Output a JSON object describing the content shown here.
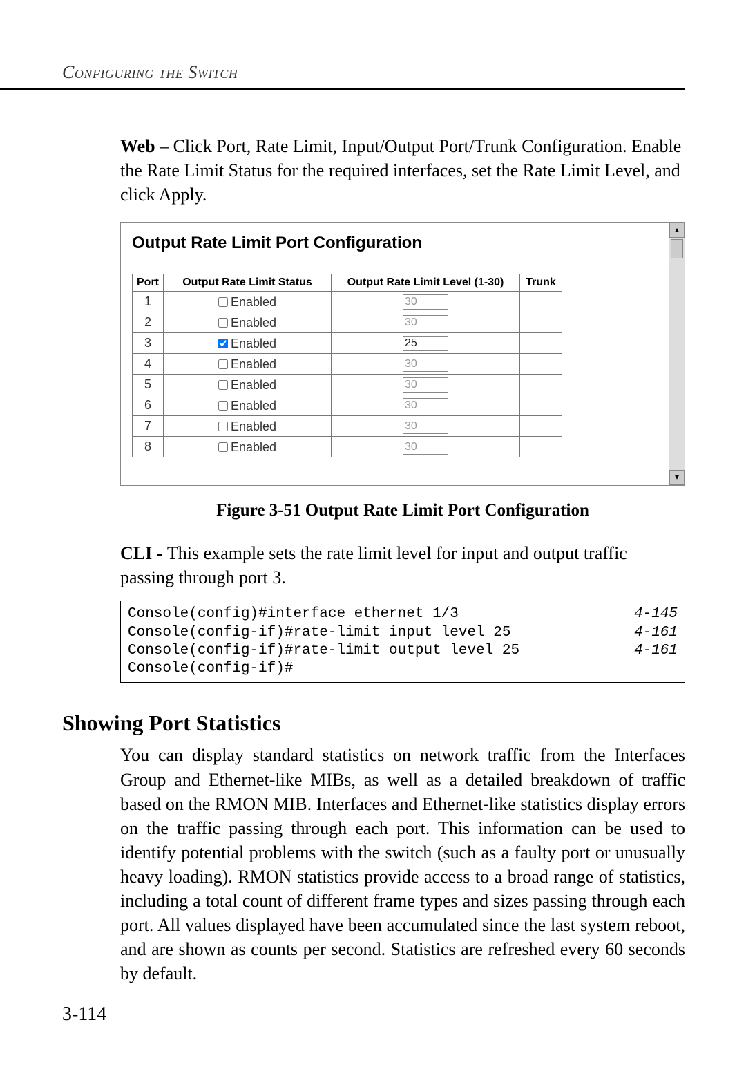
{
  "running_head": "Configuring the Switch",
  "intro": {
    "prefix_bold": "Web",
    "text_after": " – Click Port, Rate Limit, Input/Output Port/Trunk Configuration. Enable the Rate Limit Status for the required interfaces, set the Rate Limit Level, and click Apply."
  },
  "figure": {
    "panel_title": "Output Rate Limit Port Configuration",
    "caption": "Figure 3-51  Output Rate Limit Port Configuration",
    "headers": {
      "port": "Port",
      "status": "Output Rate Limit Status",
      "level": "Output Rate Limit Level (1-30)",
      "trunk": "Trunk"
    },
    "enabled_label": "Enabled",
    "rows": [
      {
        "port": "1",
        "enabled": false,
        "level": "30",
        "trunk": ""
      },
      {
        "port": "2",
        "enabled": false,
        "level": "30",
        "trunk": ""
      },
      {
        "port": "3",
        "enabled": true,
        "level": "25",
        "trunk": ""
      },
      {
        "port": "4",
        "enabled": false,
        "level": "30",
        "trunk": ""
      },
      {
        "port": "5",
        "enabled": false,
        "level": "30",
        "trunk": ""
      },
      {
        "port": "6",
        "enabled": false,
        "level": "30",
        "trunk": ""
      },
      {
        "port": "7",
        "enabled": false,
        "level": "30",
        "trunk": ""
      },
      {
        "port": "8",
        "enabled": false,
        "level": "30",
        "trunk": ""
      }
    ]
  },
  "cli_intro": {
    "prefix_bold": "CLI - ",
    "text_after": "This example sets the rate limit level for input and output traffic passing through port 3."
  },
  "cli_lines": [
    {
      "cmd": "Console(config)#interface ethernet 1/3",
      "ref": "4-145"
    },
    {
      "cmd": "Console(config-if)#rate-limit input level 25",
      "ref": "4-161"
    },
    {
      "cmd": "Console(config-if)#rate-limit output level 25",
      "ref": "4-161"
    },
    {
      "cmd": "Console(config-if)#",
      "ref": ""
    }
  ],
  "section_heading": "Showing Port Statistics",
  "section_body": "You can display standard statistics on network traffic from the Interfaces Group and Ethernet-like MIBs, as well as a detailed breakdown of traffic based on the RMON MIB. Interfaces and Ethernet-like statistics display errors on the traffic passing through each port. This information can be used to identify potential problems with the switch (such as a faulty port or unusually heavy loading). RMON statistics provide access to a broad range of statistics, including a total count of different frame types and sizes passing through each port. All values displayed have been accumulated since the last system reboot, and are shown as counts per second. Statistics are refreshed every 60 seconds by default.",
  "page_number": "3-114"
}
